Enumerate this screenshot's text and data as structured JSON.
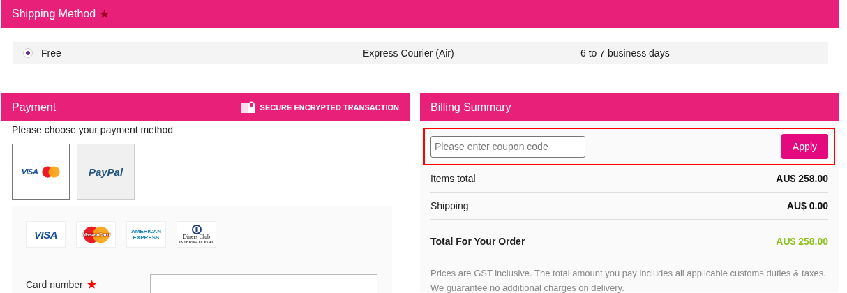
{
  "shipping": {
    "title": "Shipping Method",
    "required_mark": "★",
    "options": [
      {
        "label": "Free",
        "carrier": "Express Courier (Air)",
        "eta": "6 to 7 business days",
        "selected": true
      }
    ]
  },
  "payment": {
    "title": "Payment",
    "secure_label": "SECURE ENCRYPTED TRANSACTION",
    "prompt": "Please choose your payment method",
    "methods": [
      {
        "kind": "cards",
        "label": "VISA",
        "selected": true
      },
      {
        "kind": "paypal",
        "label": "PayPal",
        "selected": false
      }
    ],
    "accepted_cards": [
      {
        "kind": "visa",
        "label": "VISA"
      },
      {
        "kind": "mastercard",
        "label": "MasterCard"
      },
      {
        "kind": "amex",
        "label": "AMERICAN EXPRESS"
      },
      {
        "kind": "diners",
        "label": "Diners Club",
        "sublabel": "INTERNATIONAL"
      }
    ],
    "fields": [
      {
        "label": "Card number",
        "required_mark": "★"
      }
    ]
  },
  "billing": {
    "title": "Billing Summary",
    "coupon": {
      "placeholder": "Please enter coupon code",
      "button": "Apply"
    },
    "lines": [
      {
        "kind": "line",
        "label": "Items total",
        "amount": "AU$ 258.00"
      },
      {
        "kind": "line",
        "label": "Shipping",
        "amount": "AU$ 0.00"
      },
      {
        "kind": "total",
        "label": "Total For Your Order",
        "amount": "AU$ 258.00"
      }
    ],
    "note": "Prices are GST inclusive. The total amount you pay includes all applicable customs duties & taxes. We guarantee no additional charges on delivery."
  }
}
